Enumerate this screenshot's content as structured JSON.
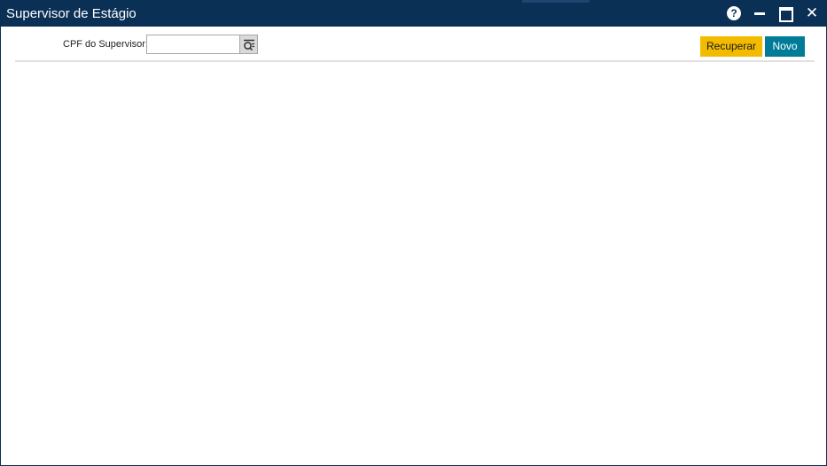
{
  "window": {
    "title": "Supervisor de Estágio",
    "controls": {
      "help_glyph": "?",
      "close_glyph": "✕"
    }
  },
  "form": {
    "cpf_label": "CPF do Supervisor:",
    "cpf_value": "",
    "cpf_placeholder": ""
  },
  "actions": {
    "recuperar_label": "Recuperar",
    "novo_label": "Novo"
  },
  "colors": {
    "titlebar": "#0b3056",
    "recuperar": "#f3bb00",
    "novo": "#007c98"
  },
  "icons": {
    "help": "help-icon",
    "minimize": "minimize-icon",
    "maximize": "maximize-icon",
    "close": "close-icon",
    "lookup": "search-list-icon"
  }
}
